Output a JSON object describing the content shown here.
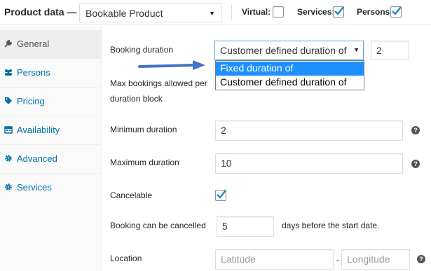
{
  "header": {
    "title": "Product data —",
    "product_type": "Bookable Product",
    "virtual_label": "Virtual:",
    "virtual_checked": false,
    "services_label": "Services:",
    "services_checked": true,
    "persons_label": "Persons:",
    "persons_checked": true
  },
  "sidebar": {
    "items": [
      {
        "label": "General",
        "icon": "wrench-icon",
        "active": true
      },
      {
        "label": "Persons",
        "icon": "persons-icon",
        "active": false
      },
      {
        "label": "Pricing",
        "icon": "tag-icon",
        "active": false
      },
      {
        "label": "Availability",
        "icon": "calendar-icon",
        "active": false
      },
      {
        "label": "Advanced",
        "icon": "gear-icon",
        "active": false
      },
      {
        "label": "Services",
        "icon": "gear-icon",
        "active": false
      }
    ]
  },
  "form": {
    "booking_duration_label": "Booking duration",
    "booking_duration_selected": "Customer defined duration of",
    "booking_duration_value": "2",
    "booking_duration_options": [
      "Fixed duration of",
      "Customer defined duration of"
    ],
    "max_bookings_label_1": "Max bookings allowed per",
    "max_bookings_label_2": "duration block",
    "min_duration_label": "Minimum duration",
    "min_duration_value": "2",
    "max_duration_label": "Maximum duration",
    "max_duration_value": "10",
    "cancelable_label": "Cancelable",
    "cancelable_checked": true,
    "cancel_window_label": "Booking can be cancelled",
    "cancel_window_value": "5",
    "cancel_window_suffix": "days before the start date.",
    "location_label": "Location",
    "latitude_placeholder": "Latitude",
    "location_separator": "-",
    "longitude_placeholder": "Longitude",
    "help_glyph": "?"
  },
  "colors": {
    "link": "#0073aa",
    "highlight": "#1e90ff",
    "annotation_arrow": "#4472c4",
    "checkmark": "#1e8cbe"
  }
}
